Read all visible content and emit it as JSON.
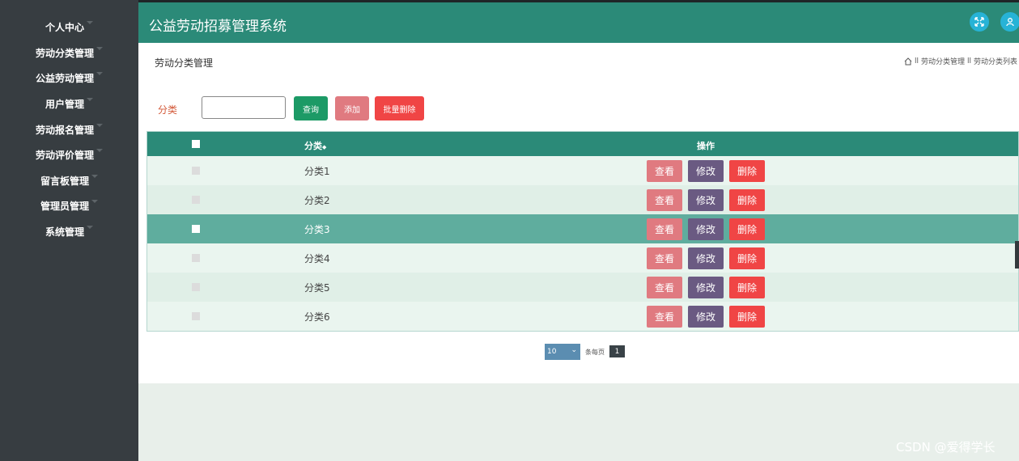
{
  "app": {
    "title": "公益劳动招募管理系统"
  },
  "sidebar": {
    "items": [
      {
        "label": "个人中心"
      },
      {
        "label": "劳动分类管理"
      },
      {
        "label": "公益劳动管理"
      },
      {
        "label": "用户管理"
      },
      {
        "label": "劳动报名管理"
      },
      {
        "label": "劳动评价管理"
      },
      {
        "label": "留言板管理"
      },
      {
        "label": "管理员管理"
      },
      {
        "label": "系统管理"
      }
    ]
  },
  "header": {
    "fullscreen_icon": "fullscreen-icon",
    "user_icon": "user-icon",
    "accent": "#2b8a78"
  },
  "page": {
    "title": "劳动分类管理",
    "breadcrumb": {
      "home_icon": "home-icon",
      "sep": "ll",
      "items": [
        "劳动分类管理",
        "劳动分类列表"
      ]
    }
  },
  "search": {
    "label": "分类",
    "value": "",
    "query_button": "查询",
    "add_button": "添加",
    "batch_delete_button": "批量删除"
  },
  "table": {
    "columns": {
      "name": "分类",
      "sort_icon": "◆",
      "actions": "操作"
    },
    "rows": [
      {
        "name": "分类1"
      },
      {
        "name": "分类2"
      },
      {
        "name": "分类3"
      },
      {
        "name": "分类4"
      },
      {
        "name": "分类5"
      },
      {
        "name": "分类6"
      }
    ],
    "actions": {
      "view": "查看",
      "edit": "修改",
      "delete": "删除"
    }
  },
  "pagination": {
    "page_size": "10",
    "per_page_label": "条每页",
    "current_page": "1"
  },
  "watermark": "CSDN @爱得学长"
}
